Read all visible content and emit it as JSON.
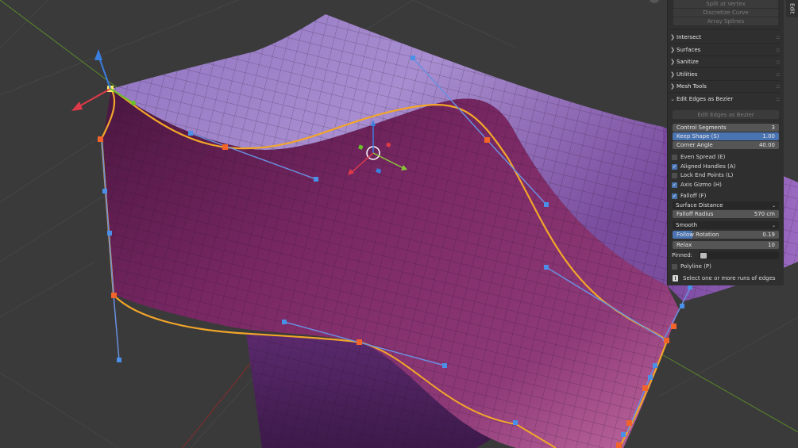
{
  "tab": {
    "label": "Edit"
  },
  "ops_buttons": [
    "Split at Vertex",
    "Discretize Curve",
    "Array Splines"
  ],
  "panels": [
    "Intersect",
    "Surfaces",
    "Sanitize",
    "Utilities",
    "Mesh Tools"
  ],
  "operator_panel": {
    "title": "Edit Edges as Bezier",
    "run_button": "Edit Edges as Bezier",
    "control_segments": {
      "label": "Control Segments",
      "value": "3"
    },
    "keep_shape": {
      "label": "Keep Shape (S)",
      "value": "1.00"
    },
    "corner_angle": {
      "label": "Corner Angle",
      "value": "40.00"
    },
    "even_spread": {
      "label": "Even Spread (E)",
      "checked": false
    },
    "aligned_handles": {
      "label": "Aligned Handles (A)",
      "checked": true
    },
    "lock_end_points": {
      "label": "Lock End Points (L)",
      "checked": false
    },
    "axis_gizmo": {
      "label": "Axis Gizmo (H)",
      "checked": true
    },
    "falloff": {
      "label": "Falloff (F)",
      "checked": true
    },
    "falloff_mode": "Surface Distance",
    "falloff_radius": {
      "label": "Falloff Radius",
      "value": "570 cm"
    },
    "falloff_curve": "Smooth",
    "follow_rotation": {
      "label": "Follow Rotation",
      "value": "0.19"
    },
    "relax": {
      "label": "Relax",
      "value": "10"
    },
    "pinned_label": "Pinned:",
    "polyline": {
      "label": "Polyline (P)",
      "checked": false
    },
    "info_message": "Select one or more runs of edges"
  },
  "colors": {
    "viewport_bg": "#3a3a3a",
    "surface_top": "#8a5fa6",
    "surface_front": "#6e2458",
    "curve": "#f2a62a",
    "handle": "#5b86d6",
    "control_point": "#f2642a",
    "accent": "#4a73b2"
  }
}
